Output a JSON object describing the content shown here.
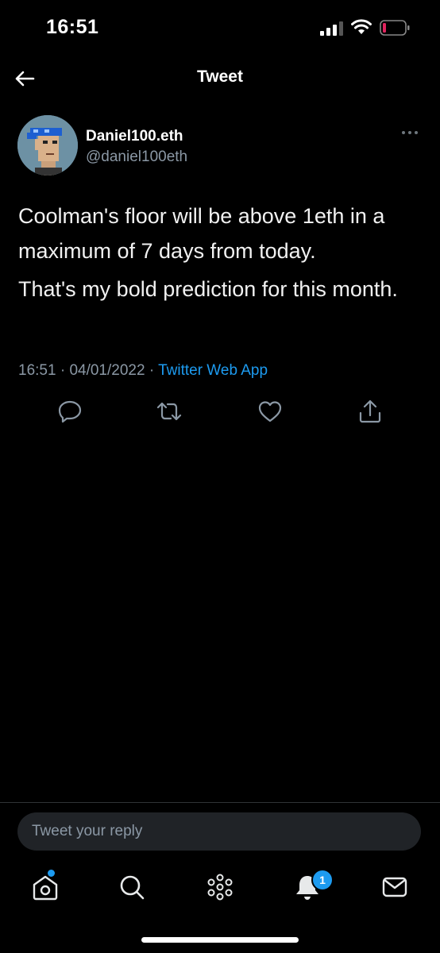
{
  "status_bar": {
    "time": "16:51"
  },
  "header": {
    "title": "Tweet",
    "back_icon": "arrow-left-icon"
  },
  "tweet": {
    "author": {
      "display_name": "Daniel100.eth",
      "handle": "@daniel100eth"
    },
    "paragraphs": [
      "Coolman's floor will be above 1eth in a maximum of 7 days from today.",
      "That's my bold prediction for this month."
    ],
    "meta": {
      "time": "16:51",
      "date": "04/01/2022",
      "source": "Twitter Web App",
      "separator": "·"
    },
    "actions": [
      "reply-icon",
      "retweet-icon",
      "like-icon",
      "share-icon"
    ]
  },
  "reply": {
    "placeholder": "Tweet your reply"
  },
  "tab_bar": {
    "items": [
      "home-icon",
      "search-icon",
      "spaces-icon",
      "notifications-icon",
      "messages-icon"
    ],
    "notification_count": "1"
  },
  "colors": {
    "background": "#000000",
    "accent": "#1d9bf0",
    "secondary_text": "#8b98a5",
    "battery_low": "#e0245e"
  }
}
